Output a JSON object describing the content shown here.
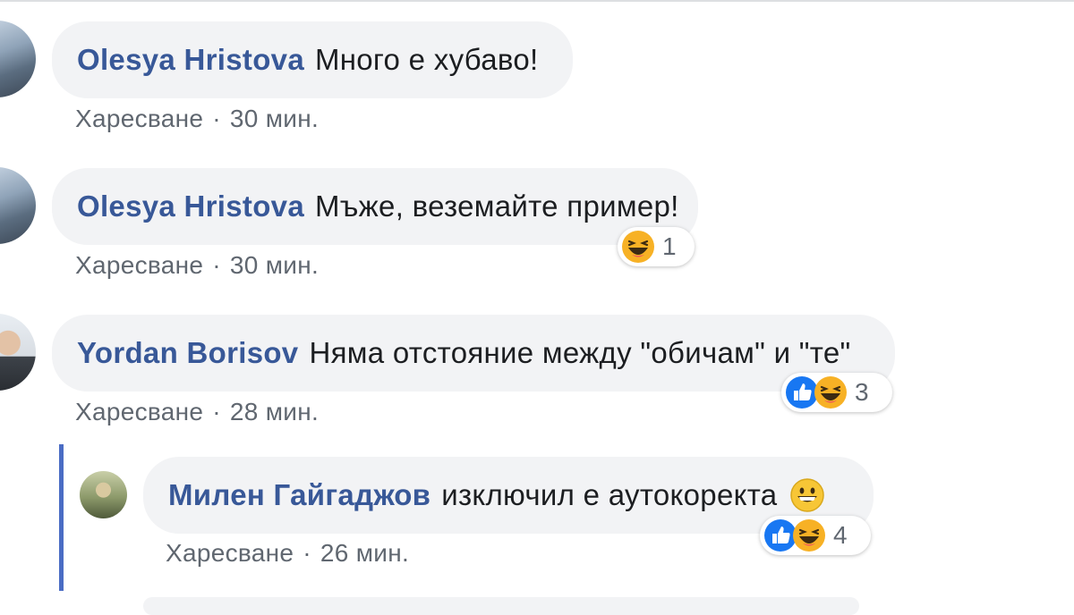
{
  "comments": [
    {
      "author": "Olesya Hristova",
      "text": "Много е хубаво!",
      "like_label": "Харесване",
      "separator": "·",
      "time": "30 мин."
    },
    {
      "author": "Olesya Hristova",
      "text": "Мъже, веземайте пример!",
      "like_label": "Харесване",
      "separator": "·",
      "time": "30 мин.",
      "reaction_count": "1",
      "reactions": [
        "haha-icon"
      ]
    },
    {
      "author": "Yordan Borisov",
      "text": "Няма отстояние между \"обичам\" и \"те\"",
      "like_label": "Харесване",
      "separator": "·",
      "time": "28 мин.",
      "reaction_count": "3",
      "reactions": [
        "like-icon",
        "haha-icon"
      ]
    },
    {
      "author": "Милен Гайгаджов",
      "text": "изключил е аутокоректа",
      "emoji": "grinning-face-icon",
      "like_label": "Харесване",
      "separator": "·",
      "time": "26 мин.",
      "reaction_count": "4",
      "reactions": [
        "like-icon",
        "haha-icon"
      ]
    }
  ],
  "colors": {
    "author": "#385898",
    "bubble": "#f2f3f5",
    "meta": "#606770",
    "thread_line": "#4a6cc4",
    "like_blue": "#1877f2",
    "haha_yellow": "#f7b125"
  }
}
